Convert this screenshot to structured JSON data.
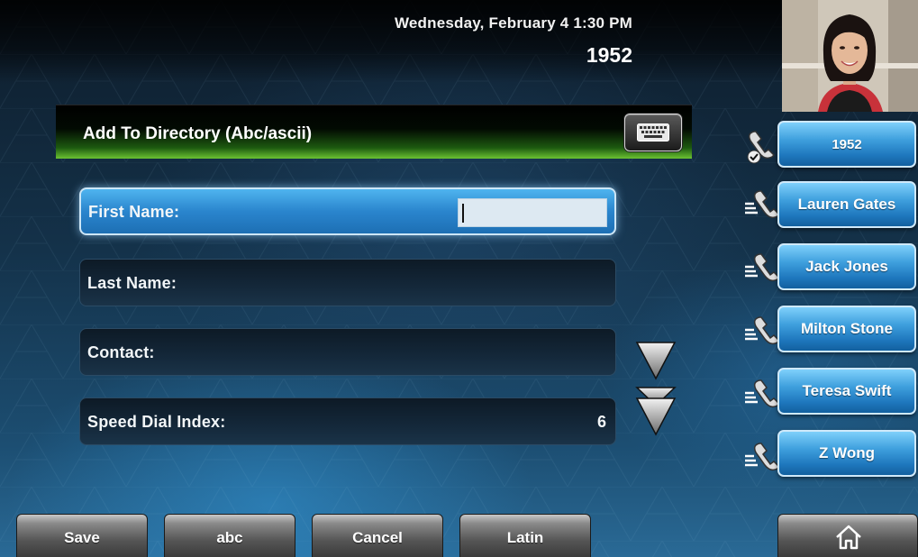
{
  "header": {
    "datetime": "Wednesday, February 4  1:30 PM",
    "extension": "1952"
  },
  "title_bar": {
    "title": "Add To Directory (Abc/ascii)",
    "keyboard_icon": "keyboard-icon"
  },
  "form": {
    "fields": [
      {
        "label": "First Name:",
        "value": "",
        "state": "active"
      },
      {
        "label": "Last Name:",
        "value": ""
      },
      {
        "label": "Contact:",
        "value": ""
      },
      {
        "label": "Speed Dial Index:",
        "value": "6"
      }
    ]
  },
  "scroll": {
    "down_icon": "scroll-down-icon",
    "page_down_icon": "page-down-icon"
  },
  "line_keys": [
    {
      "label": "1952",
      "icon": "registered-line-icon"
    },
    {
      "label": "Lauren Gates",
      "icon": "speed-dial-icon"
    },
    {
      "label": "Jack Jones",
      "icon": "speed-dial-icon"
    },
    {
      "label": "Milton Stone",
      "icon": "speed-dial-icon"
    },
    {
      "label": "Teresa Swift",
      "icon": "speed-dial-icon"
    },
    {
      "label": "Z Wong",
      "icon": "speed-dial-icon"
    }
  ],
  "softkeys": [
    "Save",
    "abc",
    "Cancel",
    "Latin"
  ],
  "home_icon": "home-icon",
  "colors": {
    "line_key_blue": "#2a8bd0",
    "title_green": "#6bc232",
    "active_field_blue": "#2a85cd"
  }
}
